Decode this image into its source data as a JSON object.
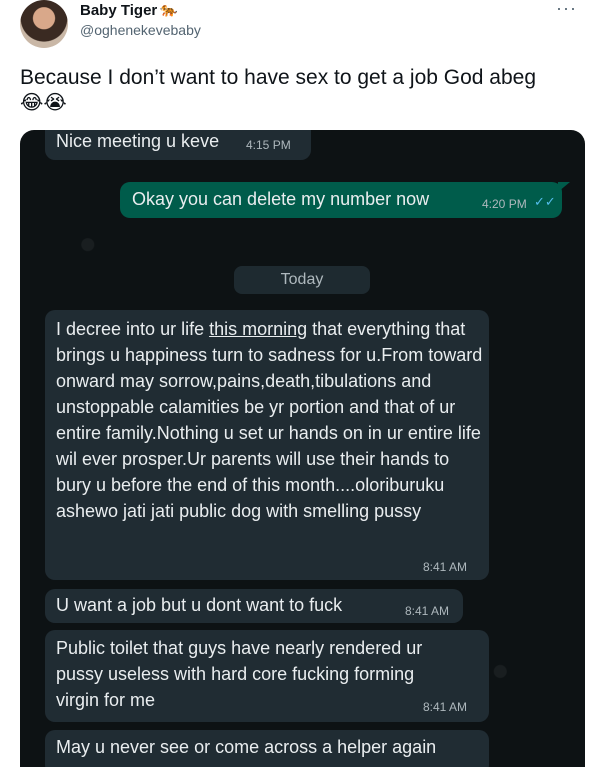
{
  "tweet": {
    "display_name": "Baby Tiger",
    "name_emoji": "🐅",
    "handle": "@oghenekevebaby",
    "more_glyph": "···",
    "text": "Because I don’t want to have sex to get a job God abeg",
    "emojis": "😂😭"
  },
  "chat": {
    "messages": [
      {
        "text": "Nice meeting u keve",
        "time": "4:15 PM"
      },
      {
        "text": "Okay you can delete my number now",
        "time": "4:20 PM",
        "ticks": "✓✓"
      },
      {
        "text_before": "I decree into ur life ",
        "text_underlined": "this morning",
        "text_after": " that everything that brings u happiness turn to sadness for u.From toward onward may sorrow,pains,death,tibulations and unstoppable calamities be yr portion and that of ur entire family.Nothing u set ur hands on in ur entire life wil ever prosper.Ur parents will use their hands to bury u before the end of this month....oloriburuku ashewo jati jati public dog with smelling pussy",
        "time": "8:41 AM"
      },
      {
        "text": "U want a job but u dont want to fuck",
        "time": "8:41 AM"
      },
      {
        "text": "Public toilet that guys have nearly rendered ur\npussy useless with hard core fucking forming\nvirgin for me",
        "time": "8:41 AM"
      },
      {
        "text": "May u never see or come across a helper again"
      }
    ],
    "date_divider": "Today"
  }
}
